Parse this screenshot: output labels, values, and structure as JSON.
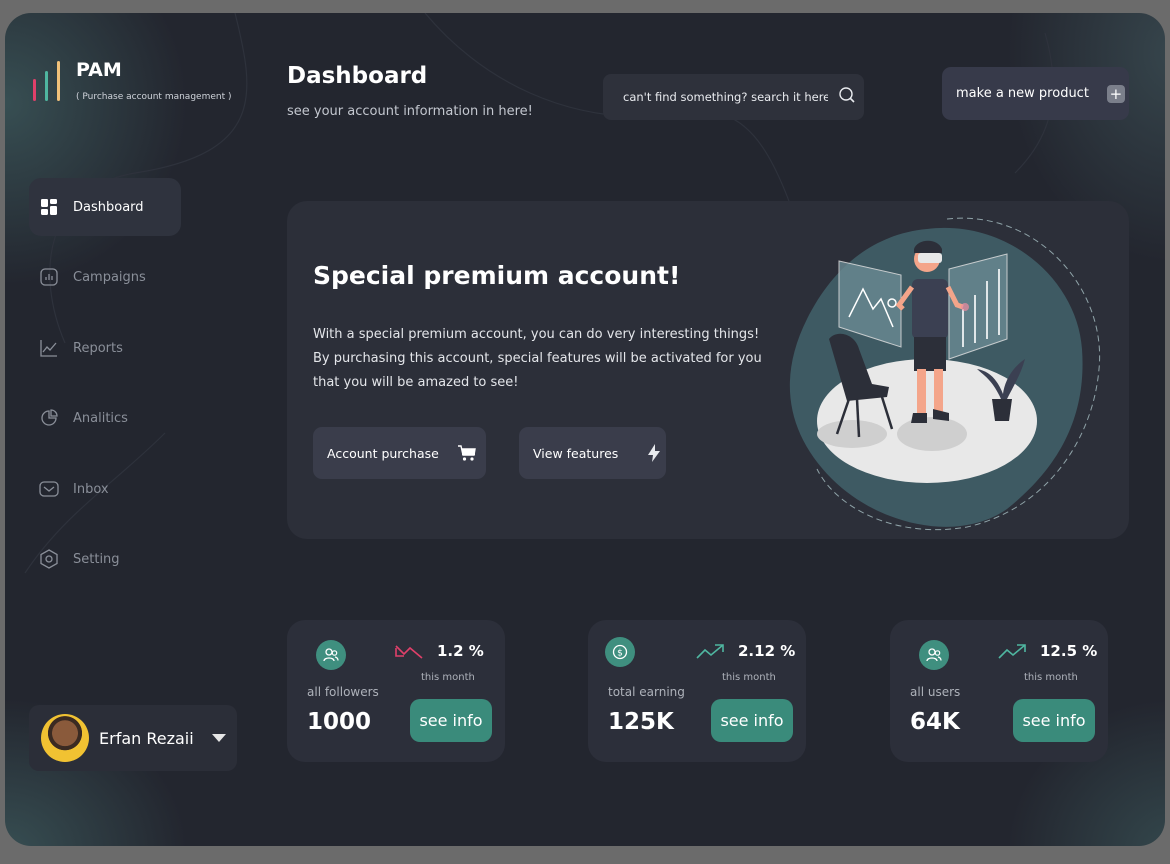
{
  "app": {
    "name": "PAM",
    "subtitle": "( Purchase account management )",
    "logo_colors": [
      "#e0406a",
      "#4fb6a0",
      "#f1c27a"
    ]
  },
  "sidebar": {
    "items": [
      {
        "label": "Dashboard",
        "icon": "dashboard-grid-icon",
        "active": true
      },
      {
        "label": "Campaigns",
        "icon": "bar-chart-icon",
        "active": false
      },
      {
        "label": "Reports",
        "icon": "line-chart-icon",
        "active": false
      },
      {
        "label": "Analitics",
        "icon": "pie-chart-icon",
        "active": false
      },
      {
        "label": "Inbox",
        "icon": "mail-icon",
        "active": false
      },
      {
        "label": "Setting",
        "icon": "gear-hexagon-icon",
        "active": false
      }
    ]
  },
  "profile": {
    "name": "Erfan Rezaii",
    "avatar_icon": "user-avatar"
  },
  "header": {
    "title": "Dashboard",
    "subtitle": "see your account information in here!",
    "search_placeholder": "can't find something? search it here!",
    "new_product_label": "make a new product"
  },
  "hero": {
    "title": "Special premium account!",
    "lines": [
      "With a special premium account, you can do very interesting things!",
      "By purchasing this account, special features will be activated for you that you will be amazed to see!"
    ],
    "buttons": {
      "purchase": "Account purchase",
      "features": "View features"
    }
  },
  "stats": [
    {
      "icon": "users-icon",
      "trend": "down",
      "percent": "1.2 %",
      "period": "this month",
      "label": "all followers",
      "value": "1000",
      "button": "see info"
    },
    {
      "icon": "dollar-coin-icon",
      "trend": "up",
      "percent": "2.12 %",
      "period": "this month",
      "label": "total earning",
      "value": "125K",
      "button": "see info"
    },
    {
      "icon": "users-icon",
      "trend": "up",
      "percent": "12.5 %",
      "period": "this month",
      "label": "all users",
      "value": "64K",
      "button": "see info"
    }
  ],
  "colors": {
    "background": "#23262f",
    "card": "#2c2f39",
    "accent_teal": "#3a8b7b",
    "trend_up": "#4fb6a0",
    "trend_down": "#e0406a"
  }
}
